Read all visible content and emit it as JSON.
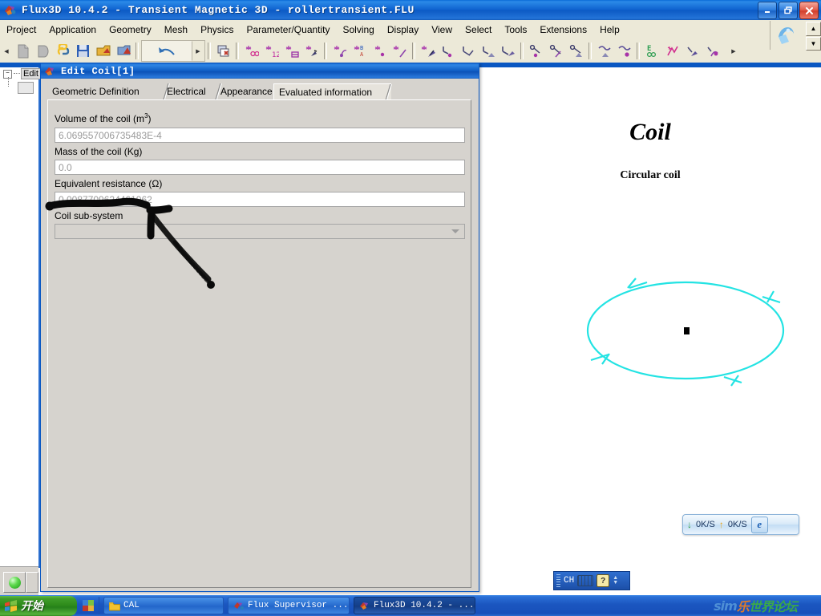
{
  "window": {
    "title": "Flux3D 10.4.2 - Transient Magnetic 3D - rollertransient.FLU",
    "icon": "flux-app-icon",
    "buttons": {
      "minimize": "_",
      "restore": "❐",
      "close": "✕"
    }
  },
  "menubar": {
    "items": [
      "Project",
      "Application",
      "Geometry",
      "Mesh",
      "Physics",
      "Parameter/Quantity",
      "Solving",
      "Display",
      "View",
      "Select",
      "Tools",
      "Extensions",
      "Help"
    ]
  },
  "toolbar": {
    "overflow_arrow": "▶",
    "left_arrow": "◀",
    "scroll_up": "▲",
    "scroll_down": "▼",
    "groups": [
      {
        "name": "file",
        "icons": [
          "new-document-icon",
          "open-document-icon",
          "python-script-icon",
          "save-icon",
          "import-icon",
          "export-icon"
        ]
      },
      {
        "name": "undo",
        "icons": [
          "undo-icon"
        ]
      },
      {
        "name": "window",
        "icons": [
          "close-window-icon"
        ]
      },
      {
        "name": "geometry",
        "icons": [
          "point-infinite-icon",
          "line-segment-icon",
          "face-build-icon",
          "extrusion-icon",
          "rotation-icon",
          "boundary-icon",
          "transform-icon",
          "assembly-icon"
        ]
      },
      {
        "name": "mesh",
        "icons": [
          "mesh-point-icon",
          "mesh-line-icon",
          "mesh-face-icon",
          "mesh-volume-icon"
        ]
      },
      {
        "name": "physics",
        "icons": [
          "material-point-icon",
          "material-line-icon",
          "material-face-icon",
          "coil-icon",
          "circuit-icon"
        ]
      },
      {
        "name": "solving",
        "icons": [
          "solve-icon",
          "post-process-icon",
          "sensor-icon",
          "spectrum-icon"
        ]
      }
    ]
  },
  "background_tree": {
    "expander": "−",
    "node_label": "Edit"
  },
  "dialog": {
    "icon": "flux-dialog-icon",
    "title": "Edit Coil[1]",
    "tabs": [
      {
        "label": "Geometric Definition",
        "selected": false
      },
      {
        "label": "Electrical",
        "selected": false
      },
      {
        "label": "Appearance",
        "selected": false
      },
      {
        "label": "Evaluated information",
        "selected": true
      }
    ],
    "fields": [
      {
        "name": "volume-of-the-coil",
        "label_prefix": "Volume of the coil (m",
        "label_sup": "3",
        "label_suffix": ")",
        "value": "6.069557006735483E-4",
        "type": "text",
        "readonly": true
      },
      {
        "name": "mass-of-the-coil",
        "label_prefix": "Mass of the coil (Kg)",
        "label_sup": "",
        "label_suffix": "",
        "value": "0.0",
        "type": "text",
        "readonly": true
      },
      {
        "name": "equivalent-resistance",
        "label_prefix": "Equivalent resistance (Ω)",
        "label_sup": "",
        "label_suffix": "",
        "value": "0.0087709624461962",
        "type": "text",
        "readonly": true
      },
      {
        "name": "coil-sub-system",
        "label_prefix": "Coil sub-system",
        "label_sup": "",
        "label_suffix": "",
        "value": "",
        "type": "combo",
        "readonly": false
      }
    ]
  },
  "viewport": {
    "title": "Coil",
    "subtitle": "Circular coil",
    "geometry": "circular-coil-ellipse",
    "coil_color": "#23e3e3",
    "center_marker_color": "#000000"
  },
  "annotation": {
    "type": "hand-drawn-arrow",
    "color": "#000000",
    "target": "equivalent-resistance-field"
  },
  "net_widget": {
    "download_arrow": "↓",
    "download_rate": "0K/S",
    "upload_arrow": "↑",
    "upload_rate": "0K/S",
    "browser_icon": "internet-explorer-icon",
    "browser_glyph": "e",
    "download_color": "#2f9e44",
    "upload_color": "#e8a317"
  },
  "ime": {
    "language": "CH",
    "keyboard_icon": "keyboard-icon",
    "help_icon": "help-icon",
    "help_glyph": "?",
    "caret_up": "▲",
    "caret_down": "▼"
  },
  "taskbar": {
    "start_label": "开始",
    "quick_launch": [
      "display-properties-icon"
    ],
    "items": [
      {
        "label": "CAL",
        "icon": "folder-icon",
        "active": false
      },
      {
        "label": "Flux Supervisor ...",
        "icon": "flux-supervisor-icon",
        "active": false
      },
      {
        "label": "Flux3D 10.4.2 - ...",
        "icon": "flux-app-icon",
        "active": true
      }
    ]
  },
  "watermark": {
    "text_left": "sim",
    "text_mid": "乐",
    "text_right": "世界论坛",
    "color_left": "#4e8fd6",
    "color_mid": "#e07b2a",
    "color_right": "#3ba84a"
  }
}
